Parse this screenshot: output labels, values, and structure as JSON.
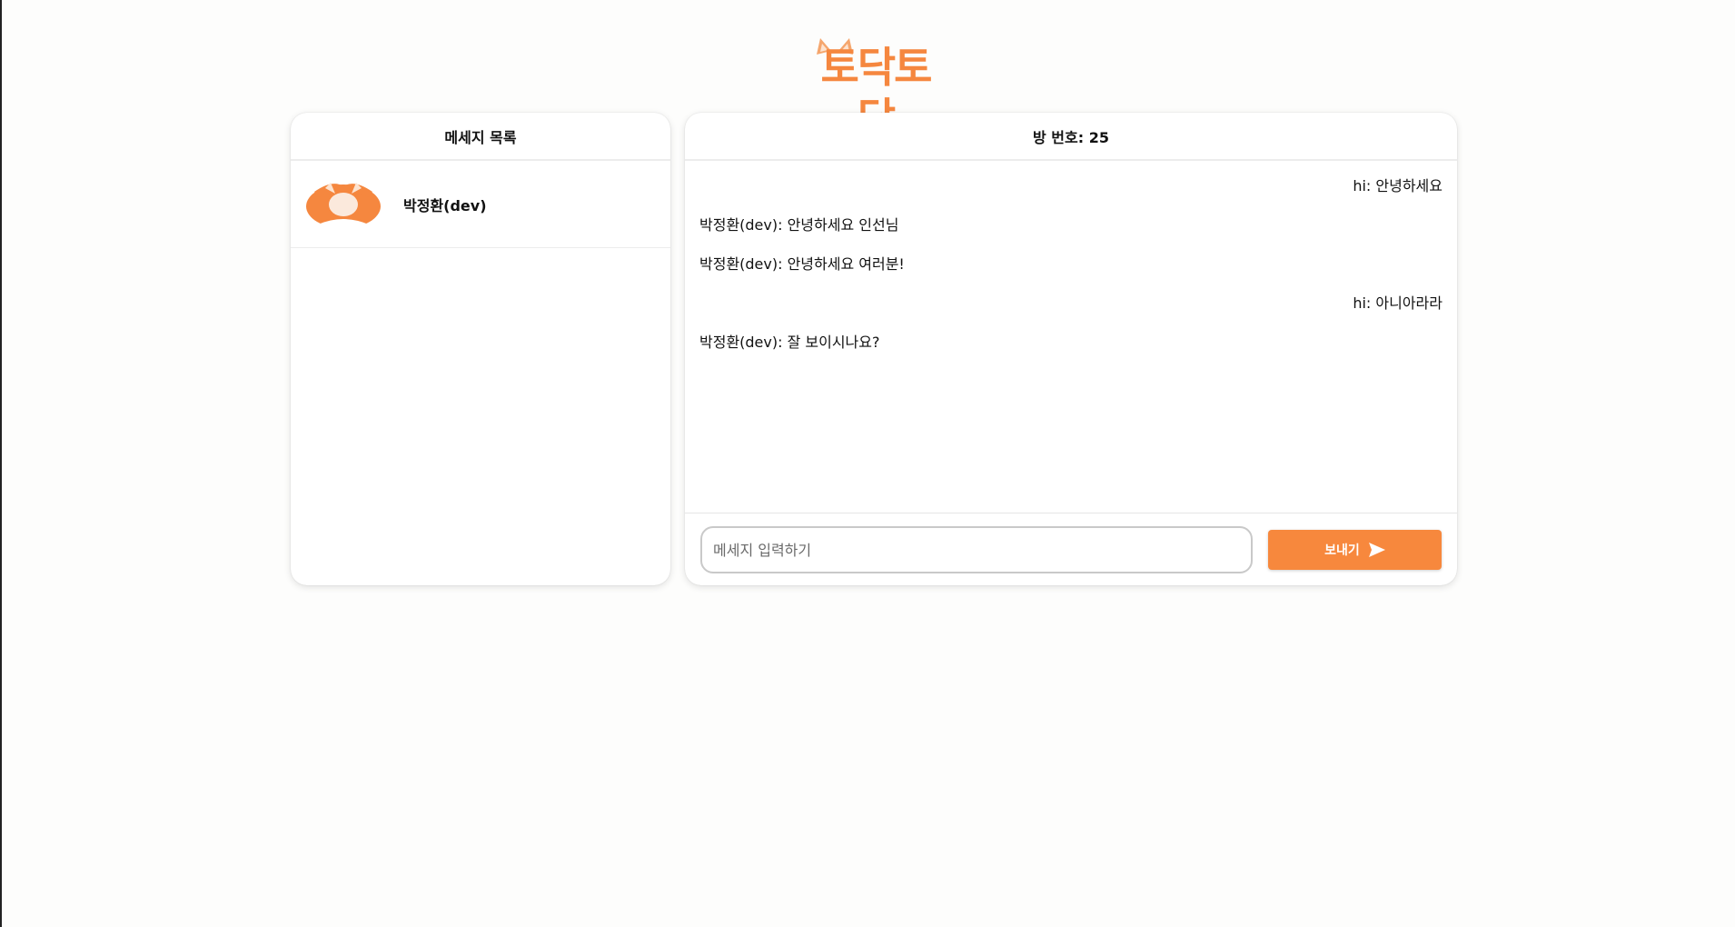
{
  "app": {
    "logo_text": "토닥토닥",
    "accent_color": "#f5873f"
  },
  "sidebar": {
    "title": "메세지 목록",
    "conversations": [
      {
        "name": "박정환(dev)",
        "avatar_icon": "fox-avatar-icon"
      }
    ]
  },
  "chat": {
    "title": "방 번호: 25",
    "messages": [
      {
        "text": "hi: 안녕하세요",
        "side": "right"
      },
      {
        "text": "박정환(dev): 안녕하세요 인선님",
        "side": "left"
      },
      {
        "text": "박정환(dev): 안녕하세요 여러분!",
        "side": "left"
      },
      {
        "text": "hi: 아니아라라",
        "side": "right"
      },
      {
        "text": "박정환(dev): 잘 보이시나요?",
        "side": "left"
      }
    ],
    "input": {
      "placeholder": "메세지 입력하기",
      "value": ""
    },
    "send_label": "보내기",
    "send_icon": "send-arrow-icon"
  }
}
